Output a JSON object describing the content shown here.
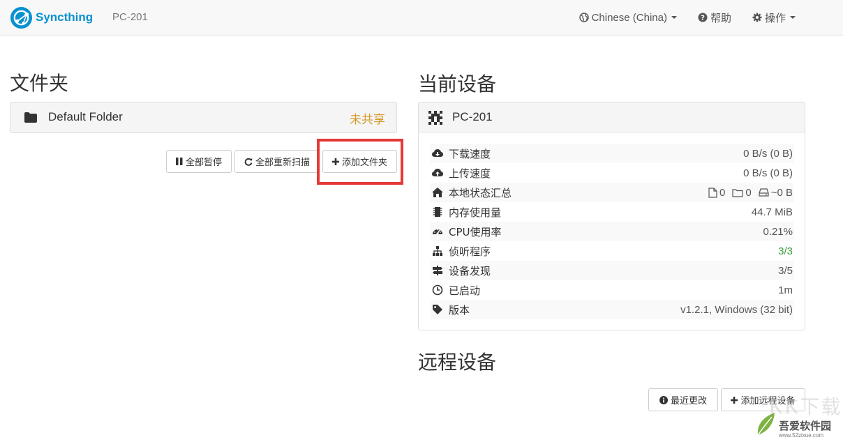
{
  "navbar": {
    "brand": "Syncthing",
    "device": "PC-201",
    "language": "Chinese (China)",
    "help": "帮助",
    "actions": "操作"
  },
  "folders": {
    "heading": "文件夹",
    "items": [
      {
        "label": "Default Folder",
        "status": "未共享",
        "status_color": "#d59a2a"
      }
    ],
    "buttons": {
      "pause_all": "全部暂停",
      "rescan_all": "全部重新扫描",
      "add_folder": "添加文件夹"
    }
  },
  "this_device": {
    "heading": "当前设备",
    "name": "PC-201",
    "rows": [
      {
        "icon": "cloud-download-icon",
        "label": "下载速度",
        "value": "0 B/s (0 B)"
      },
      {
        "icon": "cloud-upload-icon",
        "label": "上传速度",
        "value": "0 B/s (0 B)"
      },
      {
        "icon": "home-icon",
        "label": "本地状态汇总",
        "files": "0",
        "dirs": "0",
        "size": "~0 B"
      },
      {
        "icon": "memory-icon",
        "label": "内存使用量",
        "value": "44.7 MiB"
      },
      {
        "icon": "dashboard-icon",
        "label": "CPU使用率",
        "value": "0.21%"
      },
      {
        "icon": "sitemap-icon",
        "label": "侦听程序",
        "value": "3/3",
        "value_color": "#3a9d3a"
      },
      {
        "icon": "signpost-icon",
        "label": "设备发现",
        "value": "3/5"
      },
      {
        "icon": "clock-icon",
        "label": "已启动",
        "value": "1m"
      },
      {
        "icon": "tag-icon",
        "label": "版本",
        "value": "v1.2.1, Windows (32 bit)"
      }
    ]
  },
  "remote_devices": {
    "heading": "远程设备",
    "buttons": {
      "recent_changes": "最近更改",
      "add_remote": "添加远程设备"
    }
  },
  "watermark": {
    "main": "吾爱软件园",
    "sub": "www.52zixue.com",
    "big": "KK下载"
  },
  "colors": {
    "brand": "#0891d1",
    "highlight": "#e53935"
  }
}
